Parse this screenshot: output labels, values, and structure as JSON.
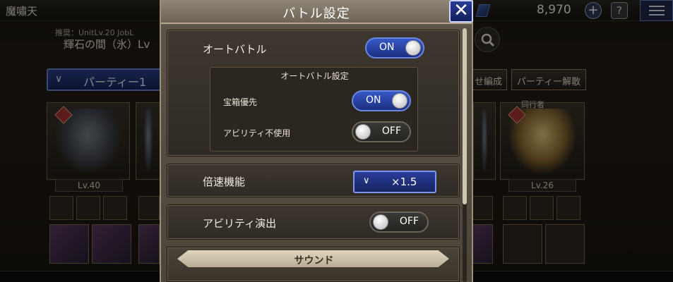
{
  "background": {
    "screen_title": "魔嘯天",
    "currency": "8,970",
    "plus_label": "+",
    "help_label": "?",
    "quest_sub": "推奨：UnitLv.20 JobL",
    "quest_name": "輝石の間（氷）Lv",
    "party_tab": "パーティー1",
    "party_chevron": "∨",
    "edit_button": "せ編成",
    "disband_button": "パーティー解散",
    "companion_label": "同行者",
    "levels": [
      "Lv.40",
      "Lv.26"
    ]
  },
  "modal": {
    "title": "バトル設定",
    "close_label": "✕",
    "auto_battle": {
      "label": "オートバトル",
      "state": "ON"
    },
    "auto_battle_settings": {
      "title": "オートバトル設定",
      "treasure_priority": {
        "label": "宝箱優先",
        "state": "ON"
      },
      "no_ability": {
        "label": "アビリティ不使用",
        "state": "OFF"
      }
    },
    "speed": {
      "label": "倍速機能",
      "value": "×1.5",
      "chevron": "∨"
    },
    "ability_effects": {
      "label": "アビリティ演出",
      "state": "OFF"
    },
    "sound": {
      "title": "サウンド"
    }
  },
  "colors": {
    "on_blue": "#3558c8",
    "panel": "#3d372f",
    "header": "#8f8677"
  }
}
